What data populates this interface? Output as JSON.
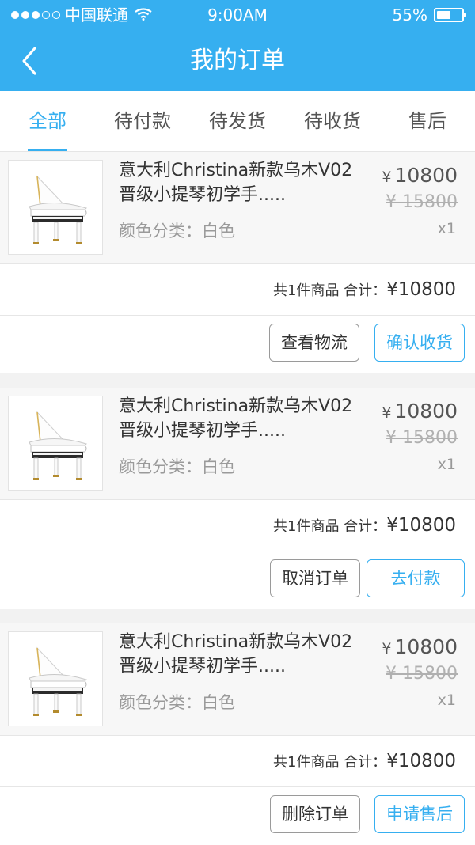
{
  "status_bar": {
    "carrier": "中国联通",
    "time": "9:00AM",
    "battery": "55%",
    "battery_level": 0.55,
    "signal_bars": 3,
    "signal_total": 5
  },
  "nav": {
    "title": "我的订单",
    "back_icon": "chevron-left-icon"
  },
  "tabs": [
    {
      "label": "全部",
      "active": true
    },
    {
      "label": "待付款",
      "active": false
    },
    {
      "label": "待发货",
      "active": false
    },
    {
      "label": "待收货",
      "active": false
    },
    {
      "label": "售后",
      "active": false
    }
  ],
  "colors": {
    "primary": "#36aff0",
    "background": "#f2f2f2"
  },
  "orders": [
    {
      "item": {
        "name": "意大利Christina新款乌木V02晋级小提琴初学手.....",
        "spec": "颜色分类：白色",
        "price_symbol": "¥",
        "price": "10800",
        "original_price": "¥ 15800",
        "qty": "x1",
        "thumb_icon": "grand-piano-image"
      },
      "summary": {
        "count_text": "共1件商品 合计：",
        "total": "¥10800"
      },
      "buttons": {
        "secondary": "查看物流",
        "primary": "确认收货"
      }
    },
    {
      "item": {
        "name": "意大利Christina新款乌木V02晋级小提琴初学手.....",
        "spec": "颜色分类：白色",
        "price_symbol": "¥",
        "price": "10800",
        "original_price": "¥ 15800",
        "qty": "x1",
        "thumb_icon": "grand-piano-image"
      },
      "summary": {
        "count_text": "共1件商品 合计：",
        "total": "¥10800"
      },
      "buttons": {
        "secondary": "取消订单",
        "primary": "去付款"
      }
    },
    {
      "item": {
        "name": "意大利Christina新款乌木V02晋级小提琴初学手.....",
        "spec": "颜色分类：白色",
        "price_symbol": "¥",
        "price": "10800",
        "original_price": "¥ 15800",
        "qty": "x1",
        "thumb_icon": "grand-piano-image"
      },
      "summary": {
        "count_text": "共1件商品 合计：",
        "total": "¥10800"
      },
      "buttons": {
        "secondary": "删除订单",
        "primary": "申请售后"
      }
    }
  ]
}
